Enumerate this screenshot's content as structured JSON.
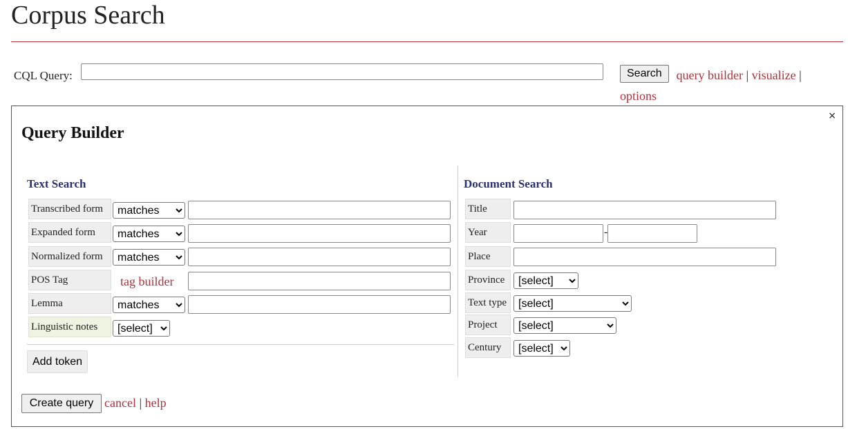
{
  "header": {
    "title": "Corpus Search"
  },
  "cql": {
    "label": "CQL Query:",
    "value": "",
    "placeholder": "",
    "search_label": "Search",
    "links": {
      "query_builder": "query builder",
      "visualize": "visualize",
      "options": "options",
      "separator": "|"
    }
  },
  "query_builder": {
    "title": "Query Builder",
    "close_label": "×",
    "text_search": {
      "heading": "Text Search",
      "rows": [
        {
          "label": "Transcribed form",
          "operator": "matches",
          "value": ""
        },
        {
          "label": "Expanded form",
          "operator": "matches",
          "value": ""
        },
        {
          "label": "Normalized form",
          "operator": "matches",
          "value": ""
        },
        {
          "label": "POS Tag",
          "link": "tag builder",
          "value": ""
        },
        {
          "label": "Lemma",
          "operator": "matches",
          "value": ""
        },
        {
          "label": "Linguistic notes",
          "select": "[select]"
        }
      ],
      "add_token_label": "Add token"
    },
    "document_search": {
      "heading": "Document Search",
      "rows": [
        {
          "label": "Title",
          "value": ""
        },
        {
          "label": "Year",
          "from": "",
          "to": "",
          "range_sep": "-"
        },
        {
          "label": "Place",
          "value": ""
        },
        {
          "label": "Province",
          "select": "[select]"
        },
        {
          "label": "Text type",
          "select": "[select]"
        },
        {
          "label": "Project",
          "select": "[select]"
        },
        {
          "label": "Century",
          "select": "[select]"
        }
      ]
    },
    "footer": {
      "create_label": "Create query",
      "cancel_label": "cancel",
      "help_label": "help",
      "separator": "|"
    }
  }
}
